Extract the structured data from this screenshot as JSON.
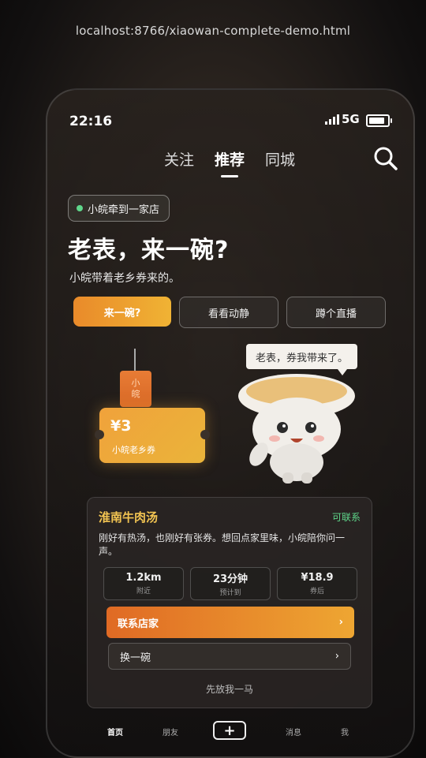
{
  "browser": {
    "url": "localhost:8766/xiaowan-complete-demo.html"
  },
  "status": {
    "time": "22:16",
    "network": "5G",
    "battery_level": 0.85
  },
  "tabs": [
    {
      "label": "关注"
    },
    {
      "label": "推荐",
      "active": true
    },
    {
      "label": "同城"
    }
  ],
  "store_badge": {
    "label": "小皖牵到一家店"
  },
  "hero": {
    "headline": "老表，来一碗?",
    "subline": "小皖带着老乡券来的。"
  },
  "actions": [
    {
      "label": "来一碗?"
    },
    {
      "label": "看看动静"
    },
    {
      "label": "蹲个直播"
    }
  ],
  "illustration": {
    "tag_chars": [
      "小",
      "皖"
    ],
    "coupon_price": "¥3",
    "coupon_name": "小皖老乡券",
    "speech": "老表，券我带来了。"
  },
  "shop": {
    "name": "淮南牛肉汤",
    "status": "可联系",
    "description": "刚好有热汤，也刚好有张券。想回点家里味，小皖陪你问一声。",
    "stats": [
      {
        "value": "1.2km",
        "label": "附近"
      },
      {
        "value": "23分钟",
        "label": "预计到"
      },
      {
        "value": "¥18.9",
        "label": "券后"
      }
    ],
    "contact_label": "联系店家",
    "change_label": "换一碗",
    "skip_label": "先放我一马"
  },
  "nav": {
    "home": "首页",
    "friends": "朋友",
    "plus": "+",
    "messages": "消息",
    "me": "我"
  },
  "colors": {
    "accent": "#f0a23b",
    "green": "#5fd78b",
    "gold": "#f2c452"
  }
}
